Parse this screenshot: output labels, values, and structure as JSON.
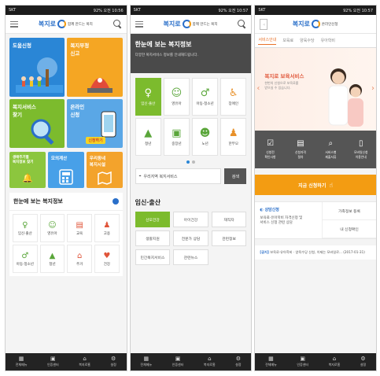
{
  "status": {
    "carrier": "SKT",
    "right": "92%  오전 10:57",
    "right_first": "92%  오전 10:56"
  },
  "app": {
    "logo": "복지로",
    "tagline": "함께 만드는 복지",
    "tagline_apply": "온라인신청"
  },
  "phone1": {
    "tiles": {
      "t1": "도움신청",
      "t2": "복지부정\n신고",
      "t3": "복지서비스\n찾기",
      "t4": "온라인\n신청",
      "t4_badge": "신청하기",
      "t5": "생애주기별\n복지정보 찾기",
      "t6": "모의계산",
      "t7": "우리동네\n복지시설"
    },
    "section_title": "한눈에 보는 복지정보",
    "categories": [
      "임신·출산",
      "영유아",
      "교육",
      "고용",
      "아동·청소년",
      "청년",
      "주거",
      "건강"
    ]
  },
  "phone2": {
    "banner_title": "한눈에 보는 복지정보",
    "banner_sub": "다양한 복지서비스 정보를 안내해드립니다.",
    "grid": [
      "임신·출산",
      "영유아",
      "아동·청소년",
      "장애인",
      "청년",
      "중장년",
      "노년",
      "한부모"
    ],
    "location_label": "우리지역 복지서비스",
    "search_btn": "검색",
    "section_title": "임신·출산",
    "buttons": [
      "산모건강",
      "아이건강",
      "재직자",
      "생활지원",
      "전문가 상담",
      "관련정보",
      "민간복지서비스",
      "관련뉴스"
    ]
  },
  "phone3": {
    "tabs": [
      "서비스안내",
      "보육료",
      "양육수당",
      "유아학비"
    ],
    "hero_title": "복지로 보육서비스",
    "hero_sub": "한번의 신청으로 보육료를\n받으실 수 있습니다.",
    "icons": [
      "신청전\n확인사항",
      "신청자격\n절차",
      "서비스별\n제출서류",
      "모바일신청\n이용안내"
    ],
    "apply_btn": "지금 신청하기",
    "consult_title": "상담신청",
    "consult_sub": "보육료·유아학비 자격신청 및\n서비스 신청 관련 상담",
    "right_items": [
      "가족정보 등록",
      "내 신청확인"
    ],
    "notice_tag": "[공지]",
    "notice_text": "보육료·유아학비 · 양육수당 신청, 이제는 모바일로... (2017-01-31)"
  },
  "nav": [
    "전체메뉴",
    "인증센터",
    "복지로홈",
    "설정"
  ]
}
